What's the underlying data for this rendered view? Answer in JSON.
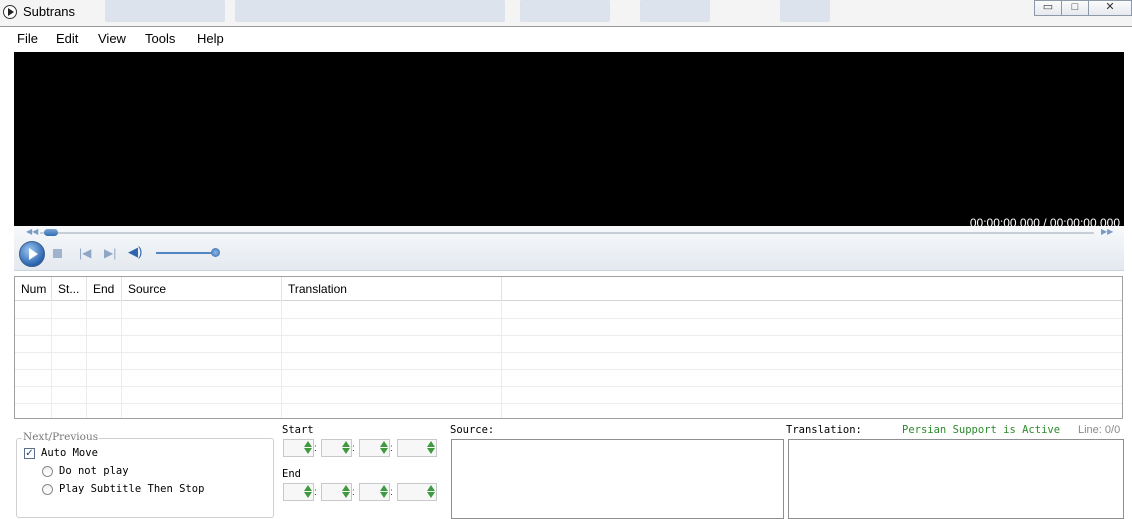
{
  "window": {
    "title": "Subtrans",
    "controls": {
      "minimize": "▭",
      "maximize": "□",
      "close": "✕"
    }
  },
  "menu": [
    "File",
    "Edit",
    "View",
    "Tools",
    "Help"
  ],
  "player": {
    "time": "00:00:00.000 / 00:00:00.000",
    "seek_progress": 0,
    "volume": 1.0,
    "icons": [
      "play-icon",
      "stop-icon",
      "previous-icon",
      "next-icon",
      "volume-icon"
    ]
  },
  "grid": {
    "columns": [
      "Num",
      "St...",
      "End",
      "Source",
      "Translation"
    ],
    "rows": []
  },
  "bottom": {
    "next_previous": {
      "title": "Next/Previous",
      "auto_move": {
        "label": "Auto Move",
        "checked": true
      },
      "options": [
        "Do not play",
        "Play Subtitle Then Stop"
      ]
    },
    "start_label": "Start",
    "end_label": "End",
    "separator": ":",
    "source_label": "Source:",
    "translation_label": "Translation:",
    "persian_status": "Persian Support is Active",
    "line_counter": "Line: 0/0"
  },
  "colors": {
    "accent": "#2f6db4",
    "status_green": "#2a8a2a",
    "spin_arrow": "#3f9a3f"
  }
}
